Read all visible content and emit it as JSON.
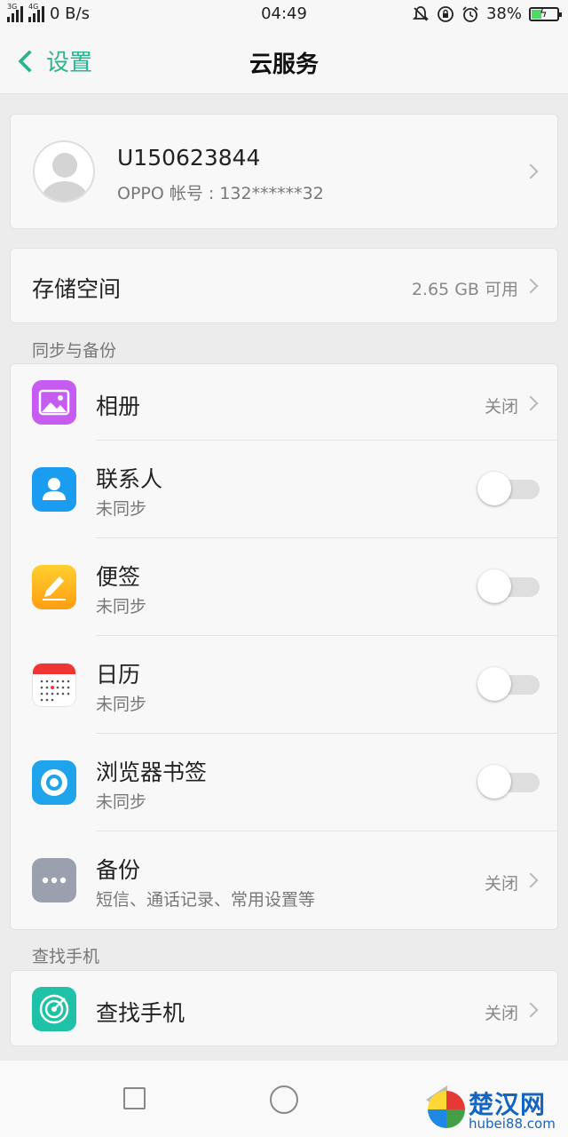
{
  "status_bar": {
    "network_left": "3G",
    "network_right": "4G",
    "speed": "0 B/s",
    "time": "04:49",
    "battery": "38%",
    "battery_level": 0.38,
    "icons": [
      "mute-icon",
      "rotation-lock-icon",
      "alarm-icon",
      "battery-icon"
    ]
  },
  "header": {
    "back_label": "设置",
    "title": "云服务"
  },
  "account": {
    "username": "U150623844",
    "subtitle": "OPPO 帐号 : 132******32"
  },
  "storage": {
    "label": "存储空间",
    "value": "2.65 GB 可用"
  },
  "sync_section": {
    "header": "同步与备份",
    "items": [
      {
        "name": "相册",
        "state": "关闭",
        "icon": "photo-icon",
        "color": "#c65cf2"
      },
      {
        "name": "联系人",
        "sub": "未同步",
        "icon": "contact-icon",
        "color": "#1a9df0",
        "toggle": false
      },
      {
        "name": "便签",
        "sub": "未同步",
        "icon": "note-icon",
        "color": "#ffb31a",
        "toggle": false
      },
      {
        "name": "日历",
        "sub": "未同步",
        "icon": "calendar-icon",
        "color": "#f03434",
        "toggle": false
      },
      {
        "name": "浏览器书签",
        "sub": "未同步",
        "icon": "browser-icon",
        "color": "#1fa3ea",
        "toggle": false
      },
      {
        "name": "备份",
        "sub": "短信、通话记录、常用设置等",
        "state": "关闭",
        "icon": "more-icon",
        "color": "#9aa0ad"
      }
    ]
  },
  "find_section": {
    "header": "查找手机",
    "item": {
      "name": "查找手机",
      "state": "关闭",
      "icon": "radar-icon",
      "color": "#1fc2a6"
    }
  },
  "watermark": {
    "text": "楚汉网",
    "url": "hubei88.com"
  }
}
